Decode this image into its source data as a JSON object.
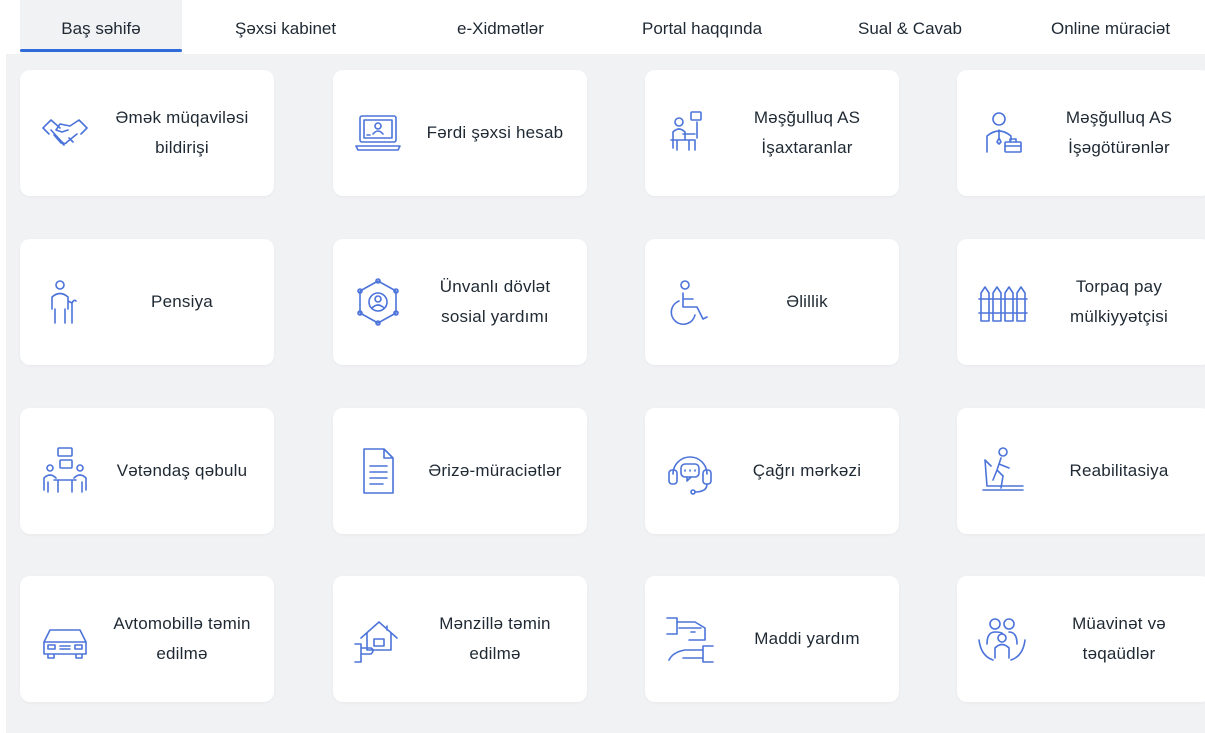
{
  "nav": {
    "items": [
      "Baş səhifə",
      "Şəxsi kabinet",
      "e-Xidmətlər",
      "Portal haqqında",
      "Sual & Cavab",
      "Online müraciət"
    ]
  },
  "colors": {
    "accent": "#2f6bdb",
    "icon": "#4b73d9",
    "background": "#f1f2f4",
    "card": "#ffffff"
  },
  "services": [
    {
      "icon": "handshake-icon",
      "lines": [
        "Əmək müqaviləsi",
        "bildirişi"
      ]
    },
    {
      "icon": "laptop-account-icon",
      "lines": [
        "Fərdi şəxsi hesab"
      ]
    },
    {
      "icon": "job-seeker-icon",
      "lines": [
        "Məşğulluq AS",
        "İşaxtaranlar"
      ]
    },
    {
      "icon": "employer-icon",
      "lines": [
        "Məşğulluq AS",
        "İşəgötürənlər"
      ]
    },
    {
      "icon": "elderly-person-icon",
      "lines": [
        "Pensiya"
      ]
    },
    {
      "icon": "network-person-icon",
      "lines": [
        "Ünvanlı dövlət",
        "sosial yardımı"
      ]
    },
    {
      "icon": "wheelchair-icon",
      "lines": [
        "Əlillik"
      ]
    },
    {
      "icon": "fence-icon",
      "lines": [
        "Torpaq pay",
        "mülkiyyətçisi"
      ]
    },
    {
      "icon": "meeting-icon",
      "lines": [
        "Vətəndaş qəbulu"
      ]
    },
    {
      "icon": "document-icon",
      "lines": [
        "Ərizə-müraciətlər"
      ]
    },
    {
      "icon": "headset-icon",
      "lines": [
        "Çağrı mərkəzi"
      ]
    },
    {
      "icon": "treadmill-icon",
      "lines": [
        "Reabilitasiya"
      ]
    },
    {
      "icon": "car-icon",
      "lines": [
        "Avtomobillə təmin",
        "edilmə"
      ]
    },
    {
      "icon": "house-hand-icon",
      "lines": [
        "Mənzillə təmin",
        "edilmə"
      ]
    },
    {
      "icon": "money-hand-icon",
      "lines": [
        "Maddi yardım"
      ]
    },
    {
      "icon": "family-icon",
      "lines": [
        "Müavinət və",
        "təqaüdlər"
      ]
    }
  ]
}
